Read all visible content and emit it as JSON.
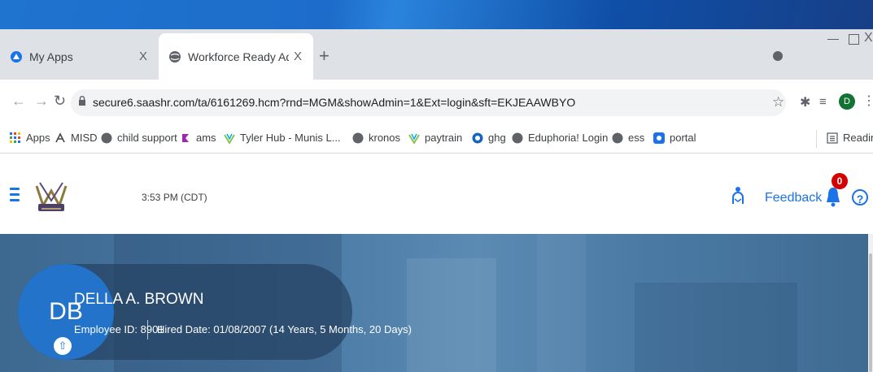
{
  "browser": {
    "tabs": [
      {
        "label": "My Apps",
        "close": "X"
      },
      {
        "label": "Workforce Ready Admin",
        "close": "X"
      }
    ],
    "new_tab": "+",
    "window_close": "X",
    "url": "secure6.saashr.com/ta/6161269.hcm?rnd=MGM&showAdmin=1&Ext=login&sft=EKJEAAWBYO",
    "profile_initial": "D",
    "bookmarks": [
      "Apps",
      "MISD",
      "child support",
      "ams",
      "Tyler Hub - Munis L...",
      "kronos",
      "paytrain",
      "ghg",
      "Eduphoria! Login",
      "ess",
      "portal"
    ],
    "reading_list": "Reading list"
  },
  "app": {
    "time": "3:53 PM (CDT)",
    "feedback": "Feedback",
    "notification_count": "0",
    "help": "?"
  },
  "employee": {
    "initials": "DB",
    "name": "DELLA A. BROWN",
    "employee_id": "Employee ID: 8901",
    "hired": "Hired Date: 01/08/2007 (14 Years, 5 Months, 20 Days)"
  },
  "colors": {
    "accent": "#1a73e8",
    "badge": "#d50000",
    "hero": "#4a7ba6",
    "avatar": "#2273c9"
  }
}
